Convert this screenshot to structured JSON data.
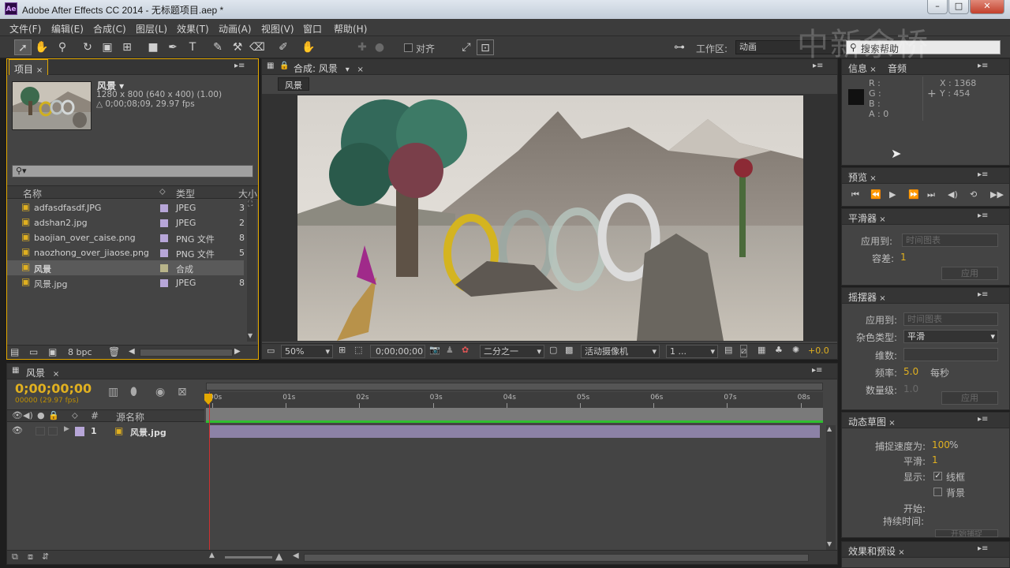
{
  "window": {
    "app_icon": "Ae",
    "title": "Adobe After Effects CC 2014 - 无标题项目.aep *",
    "minimize": "–",
    "maximize": "□",
    "close": "✕"
  },
  "menu": [
    "文件(F)",
    "编辑(E)",
    "合成(C)",
    "图层(L)",
    "效果(T)",
    "动画(A)",
    "视图(V)",
    "窗口",
    "帮助(H)"
  ],
  "toolbar": {
    "snap_label": "对齐",
    "workspace_label": "工作区:",
    "workspace_value": "动画",
    "search_placeholder": "搜索帮助",
    "watermark": "中新余桥"
  },
  "project": {
    "tab": "项目",
    "item_name": "风景 ▾",
    "item_size": "1280 x 800  (640 x 400) (1.00)",
    "item_duration": "△ 0;00;08;09, 29.97 fps",
    "search_icon": "⚲▾",
    "col_name": "名称",
    "col_type": "类型",
    "col_size": "大小",
    "files": [
      {
        "name": "adfasdfasdf.JPG",
        "type": "JPEG",
        "size": "3",
        "color": "#b7a6d8"
      },
      {
        "name": "adshan2.jpg",
        "type": "JPEG",
        "size": "2",
        "color": "#b7a6d8"
      },
      {
        "name": "baojian_over_caise.png",
        "type": "PNG 文件",
        "size": "8",
        "color": "#b7a6d8"
      },
      {
        "name": "naozhong_over_jiaose.png",
        "type": "PNG 文件",
        "size": "5",
        "color": "#b7a6d8"
      },
      {
        "name": "风景",
        "type": "合成",
        "size": "",
        "color": "#b8b48a"
      },
      {
        "name": "风景.jpg",
        "type": "JPEG",
        "size": "8",
        "color": "#b7a6d8"
      }
    ],
    "bpc": "8 bpc"
  },
  "comp": {
    "tab": "合成: 风景",
    "crumb": "风景",
    "zoom": "50%",
    "timecode": "0;00;00;00",
    "resolution": "二分之一",
    "camera": "活动摄像机",
    "views": "1 ...",
    "exposure": "+0.0"
  },
  "timeline": {
    "tab": "风景",
    "timecode": "0;00;00;00",
    "frames": "00000 (29.97 fps)",
    "col_num": "#",
    "col_source": "源名称",
    "ruler": [
      "00s",
      "01s",
      "02s",
      "03s",
      "04s",
      "05s",
      "06s",
      "07s",
      "08s"
    ],
    "layer_num": "1",
    "layer_name": "风景.jpg"
  },
  "info": {
    "tab_info": "信息",
    "tab_audio": "音频",
    "r": "R :",
    "g": "G :",
    "b": "B :",
    "a": "A : 0",
    "x": "X : 1368",
    "y": "Y : 454"
  },
  "preview": {
    "tab": "预览"
  },
  "smoother": {
    "tab": "平滑器",
    "apply_label": "应用到:",
    "apply_value": "时间图表",
    "tolerance_label": "容差:",
    "tolerance_value": "1",
    "apply_btn": "应用"
  },
  "wiggler": {
    "tab": "摇摆器",
    "apply_label": "应用到:",
    "apply_value": "时间图表",
    "noise_label": "杂色类型:",
    "noise_value": "平滑",
    "dim_label": "维数:",
    "freq_label": "频率:",
    "freq_value": "5.0",
    "freq_unit": "每秒",
    "mag_label": "数量级:",
    "mag_value": "1.0",
    "apply_btn": "应用"
  },
  "motion_sketch": {
    "tab": "动态草图",
    "speed_label": "捕捉速度为:",
    "speed_value": "100",
    "speed_unit": "%",
    "smooth_label": "平滑:",
    "smooth_value": "1",
    "show_label": "显示:",
    "wireframe": "线框",
    "background": "背景",
    "start_label": "开始:",
    "duration_label": "持续时间:",
    "capture_btn": "开始捕捉"
  },
  "effects": {
    "tab": "效果和预设"
  }
}
